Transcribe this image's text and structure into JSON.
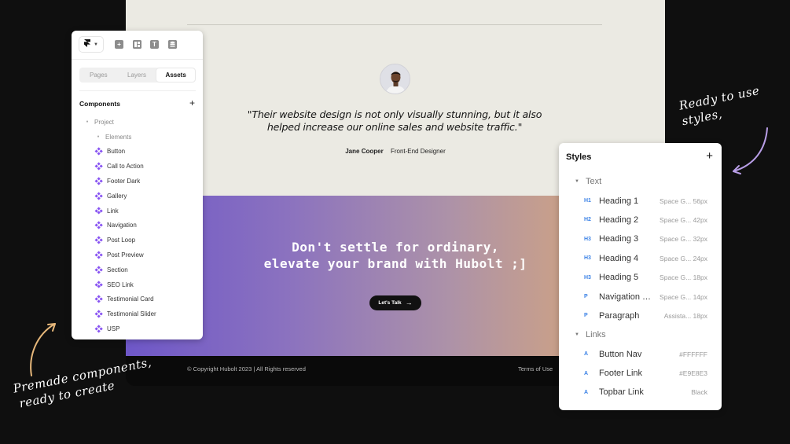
{
  "website": {
    "quote_line1": "\"Their website design is not only visually stunning, but it also",
    "quote_line2": "helped increase our online sales and website traffic.\"",
    "author_name": "Jane Cooper",
    "author_role": "Front-End Designer",
    "cta_line1": "Don't settle for ordinary,",
    "cta_line2": "elevate your brand with Hubolt ;]",
    "cta_button": "Let's Talk",
    "copyright": "© Copyright Hubolt 2023 | All Rights reserved",
    "footer_link": "Terms of Use",
    "gradient_colors": [
      "#6e57c8",
      "#dcab74"
    ]
  },
  "assets_panel": {
    "tabs": [
      "Pages",
      "Layers",
      "Assets"
    ],
    "active_tab": "Assets",
    "components_heading": "Components",
    "project_label": "Project",
    "elements_label": "Elements",
    "items": [
      "Button",
      "Call to Action",
      "Footer Dark",
      "Gallery",
      "Link",
      "Navigation",
      "Post Loop",
      "Post Preview",
      "Section",
      "SEO Link",
      "Testimonial Card",
      "Testimonial Slider",
      "USP"
    ],
    "toolbar_icons": [
      "framer-logo-icon",
      "insert-icon",
      "layout-icon",
      "text-icon",
      "cms-icon"
    ],
    "component_icon_color": "#8854f2"
  },
  "styles_panel": {
    "title": "Styles",
    "groups": [
      {
        "label": "Text",
        "items": [
          {
            "tag": "H1",
            "name": "Heading 1",
            "meta": "Space G... 56px"
          },
          {
            "tag": "H2",
            "name": "Heading 2",
            "meta": "Space G... 42px"
          },
          {
            "tag": "H3",
            "name": "Heading 3",
            "meta": "Space G... 32px"
          },
          {
            "tag": "H3",
            "name": "Heading 4",
            "meta": "Space G... 24px"
          },
          {
            "tag": "H3",
            "name": "Heading 5",
            "meta": "Space G... 18px"
          },
          {
            "tag": "P",
            "name": "Navigation Li...",
            "meta": "Space G... 14px"
          },
          {
            "tag": "P",
            "name": "Paragraph",
            "meta": "Assista... 18px"
          }
        ]
      },
      {
        "label": "Links",
        "items": [
          {
            "tag": "A",
            "name": "Button Nav",
            "meta": "#FFFFFF"
          },
          {
            "tag": "A",
            "name": "Footer Link",
            "meta": "#E9E8E3"
          },
          {
            "tag": "A",
            "name": "Topbar Link",
            "meta": "Black"
          }
        ]
      }
    ],
    "tag_color": "#3b82e6"
  },
  "callouts": {
    "right_line1": "Ready to use styles,",
    "left_line1": "Premade components,",
    "left_line2": "ready to create",
    "arrow_color": "#b89ee6",
    "arrow_color_left": "#e6b77a"
  }
}
